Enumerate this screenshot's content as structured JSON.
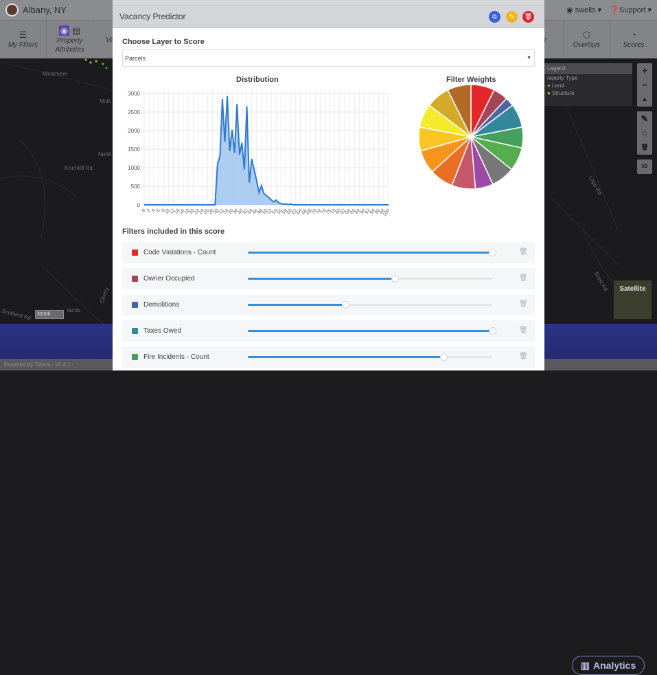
{
  "app": {
    "city": "Albany, NY",
    "user_menu": "swells ▾",
    "support_menu": "Support ▾",
    "nav": [
      {
        "label": "My Filters",
        "icon": "sliders-icon"
      },
      {
        "label": "Property Attributes",
        "icon": "building-icon"
      },
      {
        "label": "Va",
        "icon": ""
      },
      {
        "label": "r",
        "icon": ""
      },
      {
        "label": "Overlays",
        "icon": "layers-icon"
      },
      {
        "label": "Scores",
        "icon": "gauge-icon"
      }
    ],
    "map_labels": [
      "Westmere",
      "McK",
      "North",
      "Krumkill Rd",
      "Scotland Rd",
      "lands",
      "Cherry",
      "Lapp Rd",
      "Brest Rd"
    ],
    "scale": "3000ft",
    "legend": {
      "title": "Legend",
      "group": "roperty Type",
      "items": [
        "Land",
        "Structure"
      ]
    },
    "map_controls": [
      "+",
      "−",
      "▲"
    ],
    "draw_controls": [
      "✎",
      "○",
      "🗑"
    ],
    "view_3d": "3D",
    "satellite_label": "Satellite",
    "analytics_label": "Analytics",
    "footer_text": "Powered by Tolemi - v5.4.1 -"
  },
  "modal": {
    "title": "Vacancy Predictor",
    "buttons": {
      "copy": "⧉",
      "edit": "✎",
      "delete": "🗑"
    },
    "colors": {
      "copy": "#3a5fd8",
      "edit": "#f5b41c",
      "delete": "#d8282f"
    },
    "layer_label": "Choose Layer to Score",
    "layer_value": "Parcels",
    "filters_label": "Filters included in this score",
    "filters": [
      {
        "name": "Code Violations - Count",
        "color": "#e3262a",
        "weight": 1.0
      },
      {
        "name": "Owner Occupied",
        "color": "#a54656",
        "weight": 0.6
      },
      {
        "name": "Demolitions",
        "color": "#4a64a6",
        "weight": 0.4
      },
      {
        "name": "Taxes Owed",
        "color": "#35889c",
        "weight": 1.0
      },
      {
        "name": "Fire Incidents - Count",
        "color": "#44a05c",
        "weight": 0.8
      }
    ]
  },
  "chart_data": [
    {
      "type": "area",
      "title": "Distribution",
      "xlabel": "",
      "ylabel": "",
      "x": [
        0,
        2,
        4,
        6,
        8,
        10,
        12,
        14,
        16,
        18,
        20,
        22,
        24,
        26,
        28,
        30,
        32,
        34,
        36,
        38,
        40,
        42,
        44,
        46,
        48,
        50,
        52,
        54,
        56,
        58,
        60,
        62,
        64,
        66,
        68,
        70,
        72,
        74,
        76,
        78,
        80,
        82,
        84,
        86,
        88,
        90,
        92,
        94,
        96,
        98,
        100
      ],
      "x_fine": [
        29,
        30,
        31,
        32,
        33,
        34,
        35,
        36,
        37,
        38,
        39,
        40,
        41,
        42,
        43,
        44,
        45,
        46,
        47,
        48,
        49,
        50,
        51,
        52,
        53,
        54,
        55,
        56,
        57,
        58,
        59,
        60,
        61,
        62,
        63,
        64,
        65,
        66
      ],
      "values_fine": [
        0,
        1100,
        1300,
        2850,
        1700,
        2930,
        1450,
        2020,
        1400,
        2720,
        1350,
        1670,
        950,
        2660,
        600,
        1240,
        950,
        650,
        330,
        520,
        300,
        250,
        200,
        130,
        80,
        130,
        60,
        30,
        20,
        20,
        10,
        15,
        5,
        0,
        0,
        0,
        0,
        0
      ],
      "baseline": 0,
      "ylim": [
        0,
        3000
      ],
      "yticks": [
        0,
        500,
        1000,
        1500,
        2000,
        2500,
        3000
      ],
      "grid": true,
      "color": "#2f7ad0"
    },
    {
      "type": "pie",
      "title": "Filter Weights",
      "slices": [
        {
          "color": "#e3262a",
          "value": 8
        },
        {
          "color": "#a54656",
          "value": 5
        },
        {
          "color": "#4a64a6",
          "value": 3
        },
        {
          "color": "#35889c",
          "value": 8
        },
        {
          "color": "#44a05c",
          "value": 7
        },
        {
          "color": "#55ad4c",
          "value": 8
        },
        {
          "color": "#777777",
          "value": 8
        },
        {
          "color": "#9c4aa6",
          "value": 6
        },
        {
          "color": "#c25868",
          "value": 8
        },
        {
          "color": "#ea6f24",
          "value": 8
        },
        {
          "color": "#f7941c",
          "value": 8
        },
        {
          "color": "#f9c623",
          "value": 8
        },
        {
          "color": "#f5ea2c",
          "value": 8
        },
        {
          "color": "#d4ab28",
          "value": 8
        },
        {
          "color": "#b26a26",
          "value": 8
        }
      ]
    }
  ]
}
